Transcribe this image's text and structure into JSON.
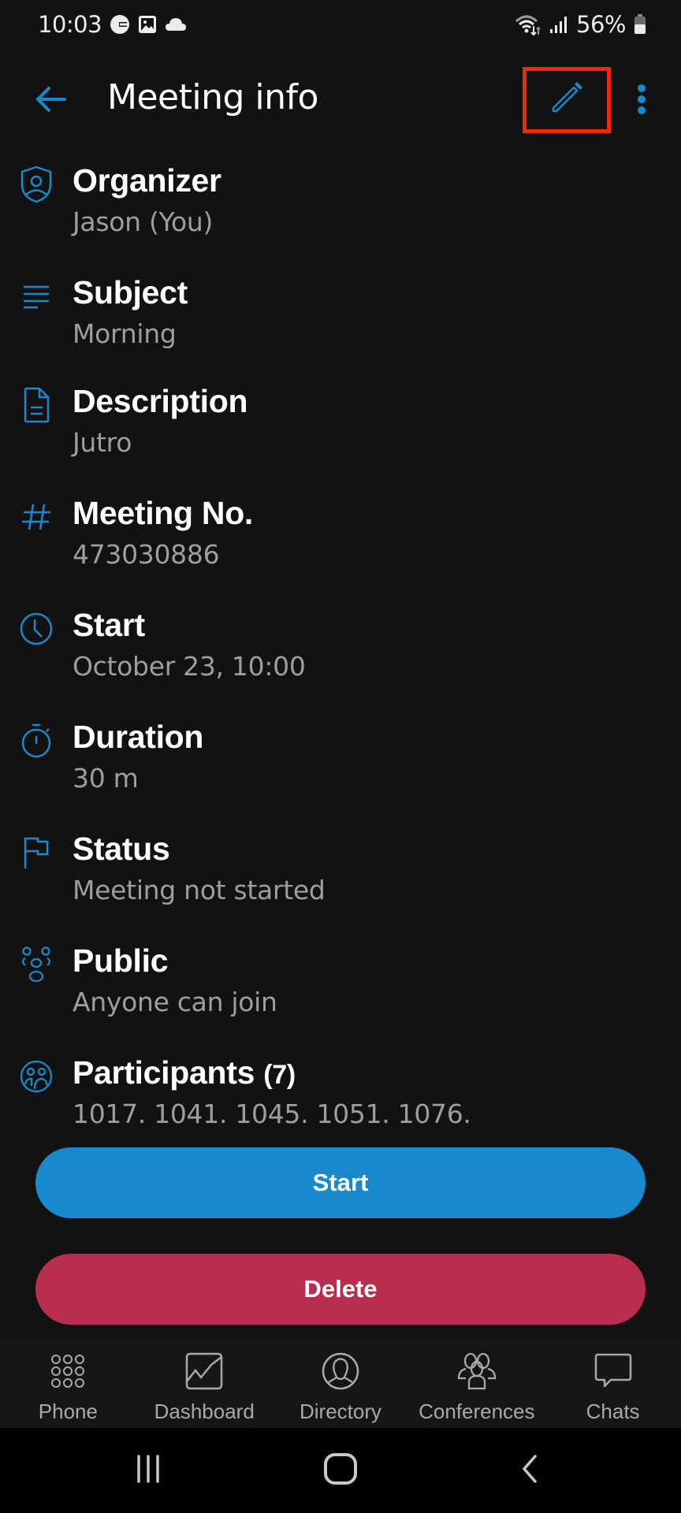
{
  "status_bar": {
    "time": "10:03",
    "left_icons": [
      "google-icon",
      "gallery-icon",
      "cloud-icon"
    ],
    "right_icons": [
      "wifi-icon",
      "signal-icon",
      "battery-icon"
    ],
    "battery_percent": "56%",
    "battery_level": 0.56
  },
  "header": {
    "title": "Meeting info",
    "back_icon": "arrow-left-icon",
    "edit_icon": "pencil-icon",
    "more_icon": "more-vertical-icon"
  },
  "accent_color": "#1789cc",
  "info": [
    {
      "icon": "shield-user-icon",
      "label": "Organizer",
      "value": "Jason (You)"
    },
    {
      "icon": "text-lines-icon",
      "label": "Subject",
      "value": "Morning"
    },
    {
      "icon": "document-icon",
      "label": "Description",
      "value": "Jutro"
    },
    {
      "icon": "hash-icon",
      "label": "Meeting No.",
      "value": "473030886"
    },
    {
      "icon": "clock-icon",
      "label": "Start",
      "value": "October 23, 10:00"
    },
    {
      "icon": "stopwatch-icon",
      "label": "Duration",
      "value": "30 m"
    },
    {
      "icon": "flag-icon",
      "label": "Status",
      "value": "Meeting not started"
    },
    {
      "icon": "group-icon",
      "label": "Public",
      "value": "Anyone can join"
    },
    {
      "icon": "participants-icon",
      "label": "Participants",
      "count": "(7)",
      "value": "1017. 1041. 1045. 1051. 1076."
    }
  ],
  "actions": {
    "start_label": "Start",
    "start_color": "#1789cc",
    "delete_label": "Delete",
    "delete_color": "#b92d4e"
  },
  "bottom_nav": [
    {
      "icon": "dialpad-icon",
      "label": "Phone"
    },
    {
      "icon": "chart-icon",
      "label": "Dashboard"
    },
    {
      "icon": "person-circle-icon",
      "label": "Directory"
    },
    {
      "icon": "people-icon",
      "label": "Conferences"
    },
    {
      "icon": "chat-bubble-icon",
      "label": "Chats"
    }
  ],
  "system_nav": [
    "recents-icon",
    "home-icon",
    "back-icon"
  ]
}
